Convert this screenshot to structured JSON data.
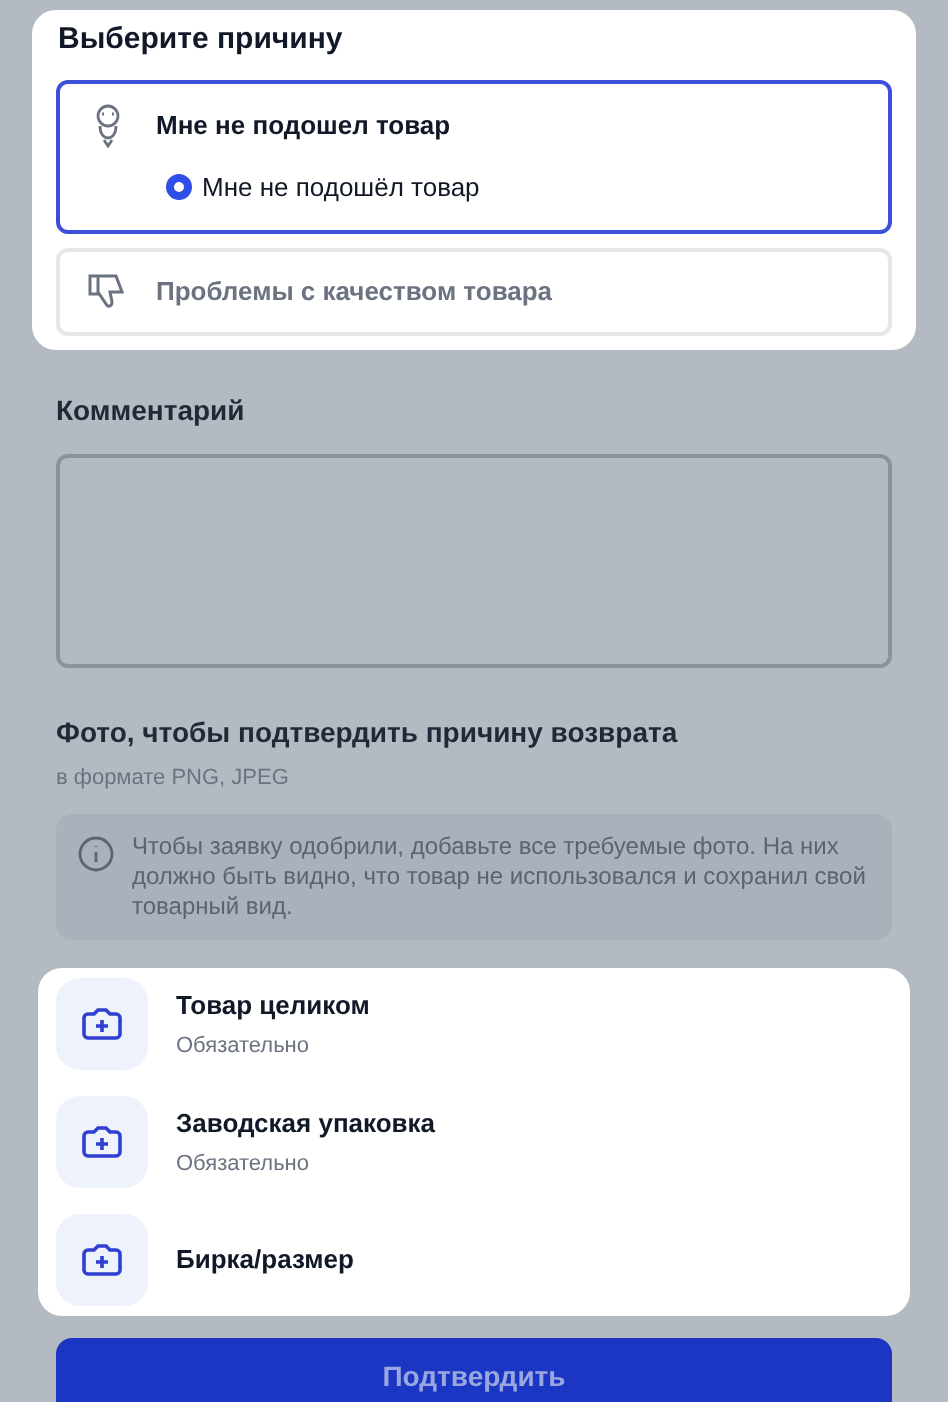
{
  "reason_section": {
    "title": "Выберите причину",
    "reasons": [
      {
        "kind": "person",
        "title": "Мне не подошел товар",
        "selected": true,
        "options": [
          {
            "label": "Мне не подошёл товар",
            "selected": true
          }
        ]
      },
      {
        "kind": "thumb",
        "title": "Проблемы с качеством товара",
        "selected": false
      }
    ]
  },
  "comment": {
    "label": "Комментарий"
  },
  "photos": {
    "title": "Фото, чтобы подтвердить причину возврата",
    "subtitle": "в формате PNG, JPEG",
    "notice": "Чтобы заявку одобрили, добавьте все требуемые фото. На них должно быть видно, что товар не использовался и сохранил свой товарный вид.",
    "items": [
      {
        "title": "Товар целиком",
        "note": "Обязательно"
      },
      {
        "title": "Заводская упаковка",
        "note": "Обязательно"
      },
      {
        "title": "Бирка/размер"
      }
    ]
  },
  "submit": {
    "label": "Подтвердить"
  }
}
